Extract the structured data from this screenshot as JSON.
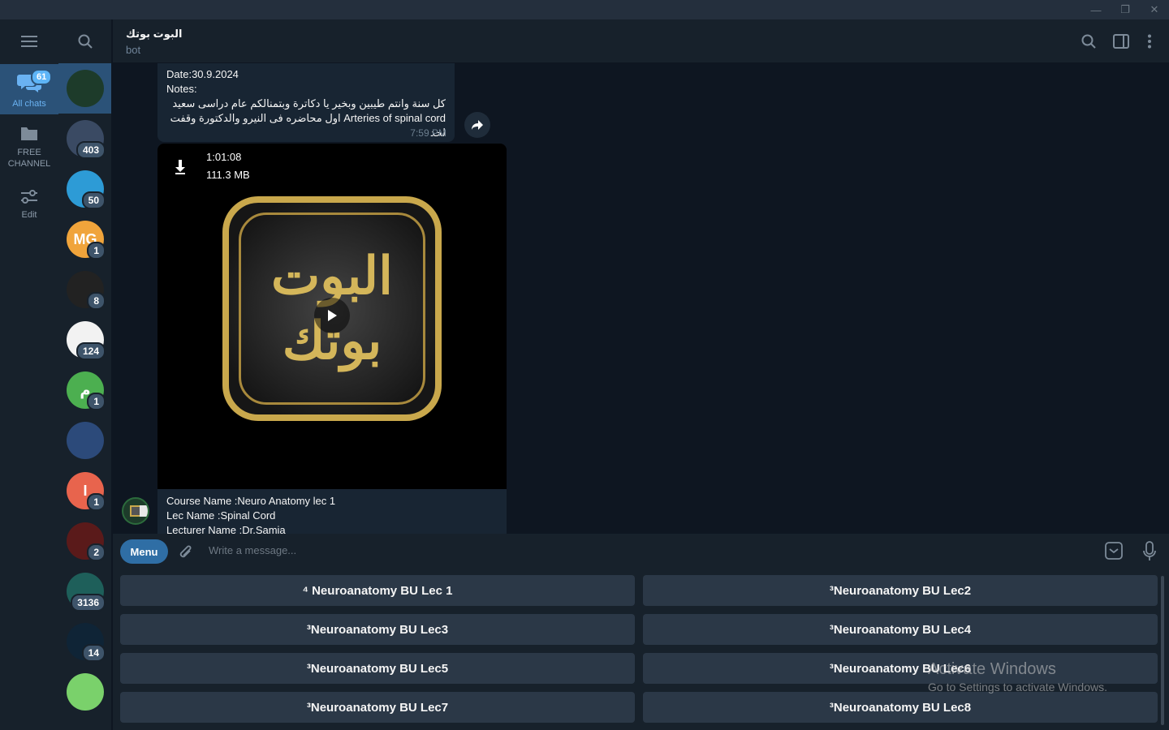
{
  "window": {
    "minimize_glyph": "—",
    "restore_glyph": "❐",
    "close_glyph": "✕"
  },
  "folders": [
    {
      "label": "All chats",
      "badge": "61",
      "icon": "chats-icon",
      "active": true
    },
    {
      "label": "FREE CHANNEL",
      "icon": "folder-icon"
    },
    {
      "label": "Edit",
      "icon": "sliders-icon"
    }
  ],
  "chats": [
    {
      "badge": "",
      "color": "#1d3b2a",
      "letter": ""
    },
    {
      "badge": "403",
      "color": "#3a4a63",
      "letter": ""
    },
    {
      "badge": "50",
      "color": "#2d9bd6",
      "letter": ""
    },
    {
      "badge": "1",
      "color": "#f0a43b",
      "letter": "MG"
    },
    {
      "badge": "8",
      "color": "#222222",
      "letter": ""
    },
    {
      "badge": "124",
      "color": "#f2f2f2",
      "letter": ""
    },
    {
      "badge": "1",
      "color": "#4caf50",
      "letter": "م"
    },
    {
      "badge": "",
      "color": "#2c4a7a",
      "letter": ""
    },
    {
      "badge": "1",
      "color": "#e8644d",
      "letter": "I"
    },
    {
      "badge": "2",
      "color": "#5a1a1a",
      "letter": ""
    },
    {
      "badge": "3136",
      "color": "#1e5f5a",
      "letter": ""
    },
    {
      "badge": "14",
      "color": "#0f2436",
      "letter": ""
    },
    {
      "badge": "",
      "color": "#7ad16b",
      "letter": ""
    }
  ],
  "header": {
    "title": "البوت بوتك",
    "subtitle": "bot"
  },
  "message1": {
    "line1": "Date:30.9.2024",
    "line2": "Notes:",
    "line3": "كل سنة وانتم طيبين وبخير يا دكاترة وبتمنالكم عام دراسى سعيد",
    "line4": "Arteries of spinal cord اول محاضره فى النيرو والدكتورة وقفت لحد",
    "time": "7:59 PM"
  },
  "video": {
    "duration": "1:01:08",
    "size": "111.3 MB",
    "logo_text": "البوت بوتك"
  },
  "message2": {
    "line1": "Course Name :Neuro Anatomy  lec 1",
    "line2": "Lec Name :Spinal Cord",
    "line3": "Lecturer Name :Dr.Samia"
  },
  "composer": {
    "menu_label": "Menu",
    "placeholder": "Write a message..."
  },
  "keyboard": [
    "⁴ Neuroanatomy BU Lec 1",
    "³Neuroanatomy BU Lec2",
    "³Neuroanatomy BU Lec3",
    "³Neuroanatomy BU Lec4",
    "³Neuroanatomy BU Lec5",
    "³Neuroanatomy BU Lec6",
    "³Neuroanatomy BU Lec7",
    "³Neuroanatomy BU Lec8"
  ],
  "watermark": {
    "line1": "Activate Windows",
    "line2": "Go to Settings to activate Windows."
  }
}
